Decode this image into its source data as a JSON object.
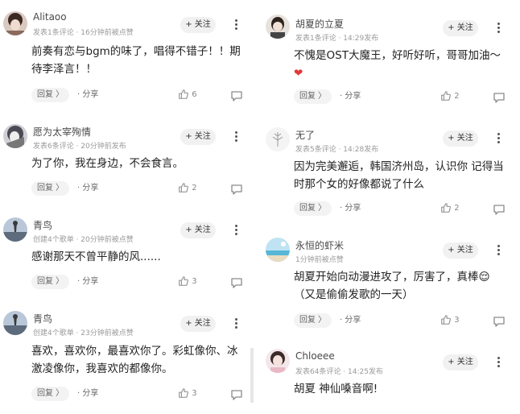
{
  "follow_label": "+ 关注",
  "reply_label": "回复 〉",
  "share_label": "· 分享",
  "left": [
    {
      "name": "Alitaoo",
      "meta": "发表1条评论 · 16分钟前被点赞",
      "text": "前奏有恋与bgm的味了，唱得不错子！！期待李泽言！！",
      "likes": "6"
    },
    {
      "name": "愿为太宰殉情",
      "meta": "发表6条评论 · 20分钟前发布",
      "text": "为了你，我在身边，不会食言。",
      "likes": "2"
    },
    {
      "name": "青鸟",
      "meta": "创建4个歌单 · 20分钟前被点赞",
      "text": "感谢那天不曾平静的风......",
      "likes": "3"
    },
    {
      "name": "青鸟",
      "meta": "创建4个歌单 · 23分钟前被点赞",
      "text": "喜欢，喜欢你，最喜欢你了。彩虹像你、冰激凌像你，我喜欢的都像你。",
      "likes": "3"
    }
  ],
  "right": [
    {
      "name": "胡夏的立夏",
      "meta": "发表1条评论 · 14:29发布",
      "text": "不愧是OST大魔王，好听好听，哥哥加油～",
      "emoji": "❤",
      "likes": "2"
    },
    {
      "name": "无了",
      "meta": "发表5条评论 · 14:28发布",
      "text": "因为完美邂逅，韩国济州岛，认识你 记得当时那个女的好像都说了什么",
      "likes": "2"
    },
    {
      "name": "永恒的虾米",
      "meta": "1分钟前被点赞",
      "text": "胡夏开始向动漫进攻了，厉害了，真棒",
      "emoji": "😌",
      "text2": "（又是偷偷发歌的一天）",
      "likes": "3"
    },
    {
      "name": "Chloeee",
      "meta": "发表64条评论 · 14:25发布",
      "text": "胡夏 神仙嗓音啊!"
    }
  ],
  "colors": {
    "follow_bg": "#f1f1f1",
    "reply_bg": "#f3f3f3",
    "meta": "#9a9a9a",
    "heart": "#e0393a"
  }
}
